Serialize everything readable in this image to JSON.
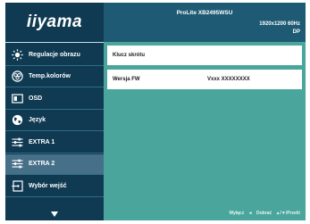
{
  "sidebar": {
    "logo": "iiyama",
    "items": [
      {
        "label": "Regulacje obrazu",
        "icon": "brightness-icon"
      },
      {
        "label": "Temp.kolorów",
        "icon": "color-palette-icon"
      },
      {
        "label": "OSD",
        "icon": "osd-screen-icon"
      },
      {
        "label": "Język",
        "icon": "globe-icon"
      },
      {
        "label": "EXTRA 1",
        "icon": "sliders-icon"
      },
      {
        "label": "EXTRA 2",
        "icon": "sliders-icon",
        "selected": true
      },
      {
        "label": "Wybór wejść",
        "icon": "input-select-icon"
      }
    ],
    "scroll_icon": "down-arrow-icon"
  },
  "header": {
    "model": "ProLite XB2495WSU",
    "resolution": "1920x1200 60Hz",
    "input": "DP"
  },
  "content": {
    "rows": [
      {
        "key": "Klucz skrótu",
        "value": ""
      },
      {
        "key": "Wersja FW",
        "value": "Vxxx XXXXXXXX"
      }
    ]
  },
  "footer": {
    "exit_label": "Wyłącz",
    "exit_symbol": "◄",
    "enter_label": "Dobrać",
    "enter_symbol": "▲/▼/Przełć"
  },
  "colors": {
    "background": "#4aa69c",
    "sidebar": "#0f3a52",
    "selected": "#466f88",
    "header": "#1e5a74"
  }
}
